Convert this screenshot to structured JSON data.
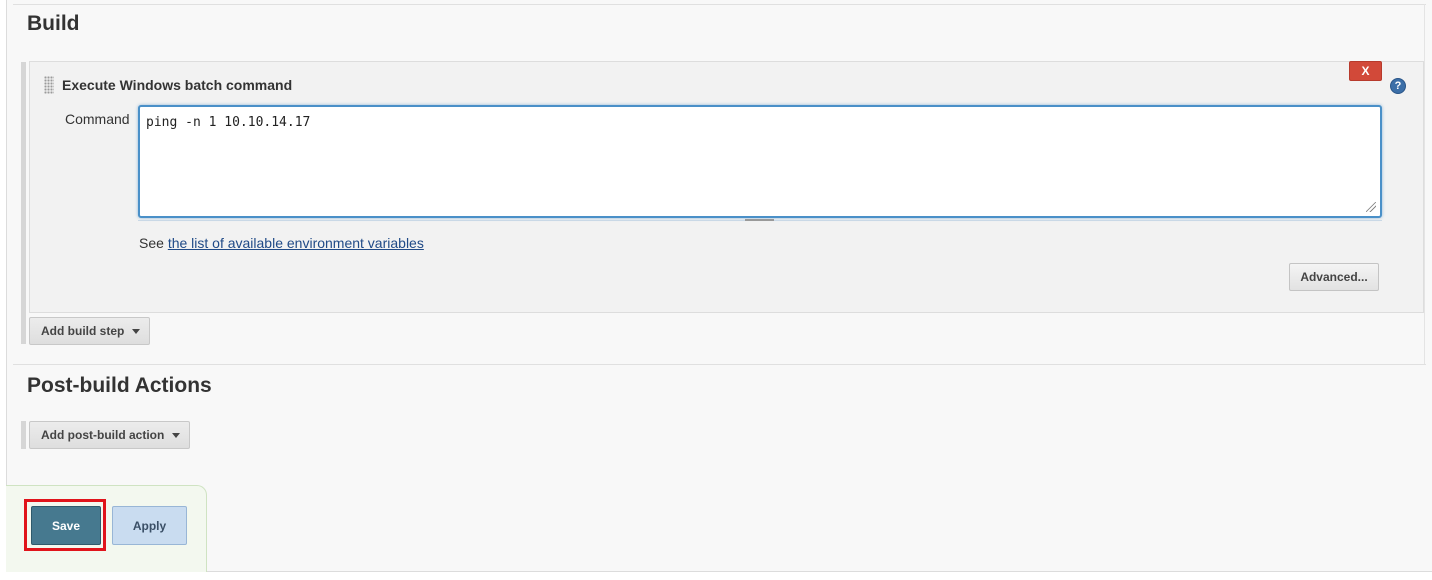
{
  "build_section": {
    "heading": "Build",
    "step": {
      "title": "Execute Windows batch command",
      "delete_label": "X",
      "help_label": "?",
      "command_label": "Command",
      "command_value": "ping -n 1 10.10.14.17",
      "env_prefix": "See ",
      "env_link_text": "the list of available environment variables",
      "advanced_label": "Advanced..."
    },
    "add_step_label": "Add build step"
  },
  "post_build_section": {
    "heading": "Post-build Actions",
    "add_action_label": "Add post-build action"
  },
  "bottom_bar": {
    "save_label": "Save",
    "apply_label": "Apply"
  },
  "colors": {
    "save_button": "#46798f",
    "apply_button": "#c9dcf0",
    "delete_button": "#d24939",
    "highlight": "#e0141b",
    "link": "#204a87",
    "textarea_focus": "#4a90c8"
  }
}
